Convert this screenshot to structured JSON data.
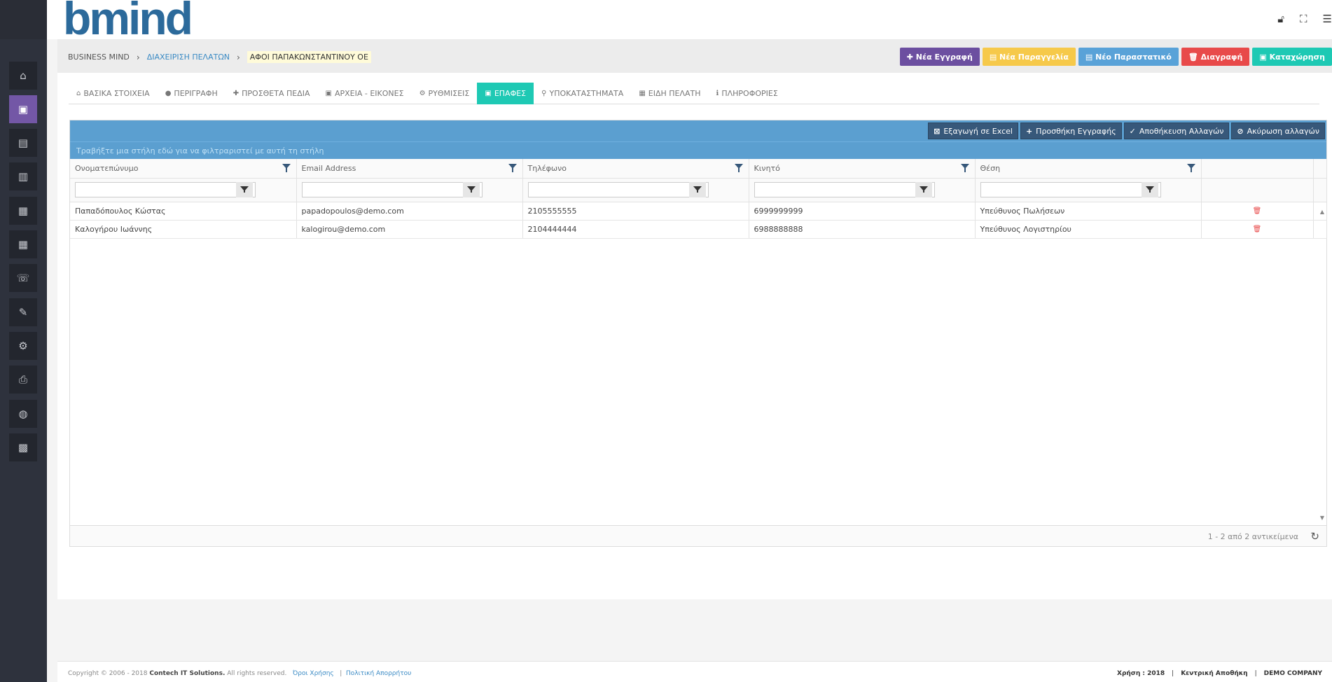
{
  "header": {
    "logo": "bmind",
    "icons": [
      "lock-icon",
      "fullscreen-icon",
      "menu-icon"
    ]
  },
  "sidebar": {
    "items": [
      {
        "name": "home-icon",
        "glyph": "⌂"
      },
      {
        "name": "contacts-icon",
        "glyph": "▣"
      },
      {
        "name": "address-book-icon",
        "glyph": "▤"
      },
      {
        "name": "archive-icon",
        "glyph": "▥"
      },
      {
        "name": "document-icon",
        "glyph": "▦"
      },
      {
        "name": "calendar-icon",
        "glyph": "▦"
      },
      {
        "name": "phone-icon",
        "glyph": "☏"
      },
      {
        "name": "wrench-icon",
        "glyph": "✎"
      },
      {
        "name": "gear-icon",
        "glyph": "⚙"
      },
      {
        "name": "printer-icon",
        "glyph": "⎙"
      },
      {
        "name": "globe-icon",
        "glyph": "◍"
      },
      {
        "name": "briefcase-icon",
        "glyph": "▩"
      }
    ],
    "active_index": 1
  },
  "breadcrumb": {
    "root": "BUSINESS MIND",
    "section": "ΔΙΑΧΕΙΡΙΣΗ ΠΕΛΑΤΩΝ",
    "current": "ΑΦΟΙ ΠΑΠΑΚΩΝΣΤΑΝΤΙΝΟΥ ΟΕ",
    "separator": "›"
  },
  "actions": {
    "new_entry": "✚ Νέα Εγγραφή",
    "new_order": "▤ Νέα Παραγγελία",
    "new_document": "▤ Νέο Παραστατικό",
    "delete": "🗑 Διαγραφή",
    "save": "▣ Καταχώρηση"
  },
  "tabs": [
    {
      "icon": "⌂",
      "label": "ΒΑΣΙΚΑ ΣΤΟΙΧΕΙΑ"
    },
    {
      "icon": "●",
      "label": "ΠΕΡΙΓΡΑΦΗ"
    },
    {
      "icon": "✚",
      "label": "ΠΡΟΣΘΕΤΑ ΠΕΔΙΑ"
    },
    {
      "icon": "▣",
      "label": "ΑΡΧΕΙΑ - ΕΙΚΟΝΕΣ"
    },
    {
      "icon": "⚙",
      "label": "ΡΥΘΜΙΣΕΙΣ"
    },
    {
      "icon": "▣",
      "label": "ΕΠΑΦΕΣ"
    },
    {
      "icon": "⚲",
      "label": "ΥΠΟΚΑΤΑΣΤΗΜΑΤΑ"
    },
    {
      "icon": "▦",
      "label": "ΕΙΔΗ ΠΕΛΑΤΗ"
    },
    {
      "icon": "ℹ",
      "label": "ΠΛΗΡΟΦΟΡΙΕΣ"
    }
  ],
  "active_tab": 5,
  "grid": {
    "toolbar": {
      "export": "Εξαγωγή σε Excel",
      "add": "Προσθήκη Εγγραφής",
      "save": "Αποθήκευση Αλλαγών",
      "cancel": "Ακύρωση αλλαγών"
    },
    "group_hint": "Τραβήξτε μια στήλη εδώ για να φιλτραριστεί με αυτή τη στήλη",
    "columns": [
      "Ονοματεπώνυμο",
      "Email Address",
      "Τηλέφωνο",
      "Κινητό",
      "Θέση"
    ],
    "rows": [
      {
        "name": "Παπαδόπουλος Κώστας",
        "email": "papadopoulos@demo.com",
        "phone": "2105555555",
        "mobile": "6999999999",
        "position": "Υπεύθυνος Πωλήσεων"
      },
      {
        "name": "Καλογήρου Ιωάννης",
        "email": "kalogirou@demo.com",
        "phone": "2104444444",
        "mobile": "6988888888",
        "position": "Υπεύθυνος Λογιστηρίου"
      }
    ],
    "pager": "1 - 2 από 2 αντικείμενα"
  },
  "footer": {
    "copyright": "Copyright © 2006 - 2018",
    "company": "Contech IT Solutions.",
    "rights": "All rights reserved.",
    "terms": "Όροι Χρήσης",
    "privacy": "Πολιτική Απορρήτου",
    "year": "Χρήση : 2018",
    "warehouse": "Κεντρική Αποθήκη",
    "company_name": "DEMO COMPANY"
  }
}
